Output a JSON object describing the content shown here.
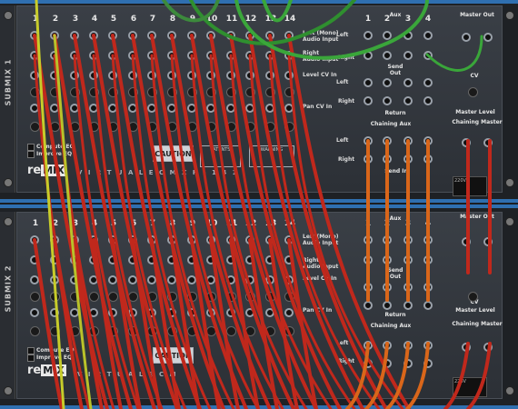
{
  "device_top": {
    "side_label": "SUBMIX 1",
    "logo_prefix": "re",
    "logo_mix": "MIX",
    "model_text": "V I R T U A L   E C   M X R - 1 4 1",
    "plate_caution": "CAUTION",
    "plate_patents": "PATENTS",
    "plate_warning": "WARNING",
    "compute_eq": "Compute EQ",
    "improve_eq": "Improve EQ"
  },
  "device_bot": {
    "side_label": "SUBMIX 2",
    "logo_prefix": "re",
    "logo_mix": "MIX",
    "model_text": "V I R T U A L   E C   M",
    "plate_caution": "CAUTION",
    "compute_eq": "Compute EQ",
    "improve_eq": "Improve EQ"
  },
  "channels": [
    "1",
    "2",
    "3",
    "4",
    "5",
    "6",
    "7",
    "8",
    "9",
    "10",
    "11",
    "12",
    "13",
    "14"
  ],
  "labels": {
    "left_mono": "Left (Mono)",
    "audio_input": "Audio Input",
    "right": "Right",
    "audio_input_r": "Audio Input",
    "level_cv_in": "Level CV In",
    "pan_cv_in": "Pan CV In",
    "aux": "Aux",
    "aux_nums": [
      "1",
      "2",
      "3",
      "4"
    ],
    "send_out": "Send Out",
    "return": "Return",
    "left_mono_aux": "Left\n(Mono)",
    "left": "Left",
    "master_out": "Master Out",
    "cv": "CV",
    "master_level": "Master Level",
    "chaining_aux": "Chaining Aux",
    "chaining_master": "Chaining Master",
    "send_in": "Send In",
    "volt": "220V"
  },
  "colors": {
    "cable_red": "#c0281c",
    "cable_orange": "#d9661a",
    "cable_green": "#3aa63a",
    "cable_yellow": "#c7cc2a",
    "rail_blue": "#2f6fb0"
  }
}
